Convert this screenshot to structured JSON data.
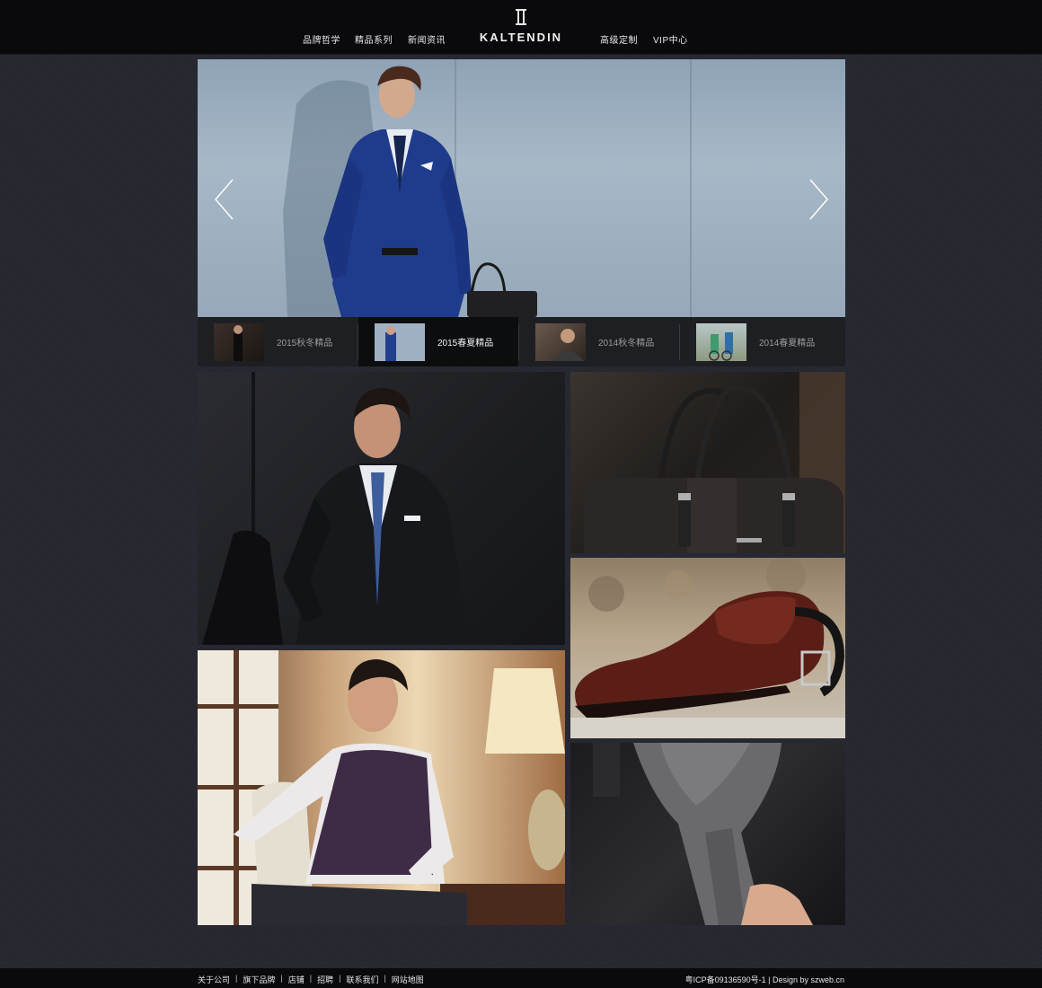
{
  "header": {
    "nav_left": [
      "品牌哲学",
      "精品系列",
      "新闻资讯"
    ],
    "logo_text": "KALTENDIN",
    "nav_right": [
      "高级定制",
      "VIP中心"
    ]
  },
  "slider": {
    "thumbnails": [
      {
        "label": "2015秋冬精品",
        "active": false
      },
      {
        "label": "2015春夏精品",
        "active": true
      },
      {
        "label": "2014秋冬精品",
        "active": false
      },
      {
        "label": "2014春夏精品",
        "active": false
      }
    ],
    "prev_icon": "chevron-left-icon",
    "next_icon": "chevron-right-icon"
  },
  "footer": {
    "links": [
      "关于公司",
      "旗下品牌",
      "店铺",
      "招聘",
      "联系我们",
      "网站地图"
    ],
    "separator": "|",
    "copyright": "粤ICP备09136590号-1 | Design by szweb.cn"
  },
  "colors": {
    "page_bg": "#262730",
    "header_bg": "#0a0a0d",
    "thumb_bar_bg": "#1d1f23"
  }
}
